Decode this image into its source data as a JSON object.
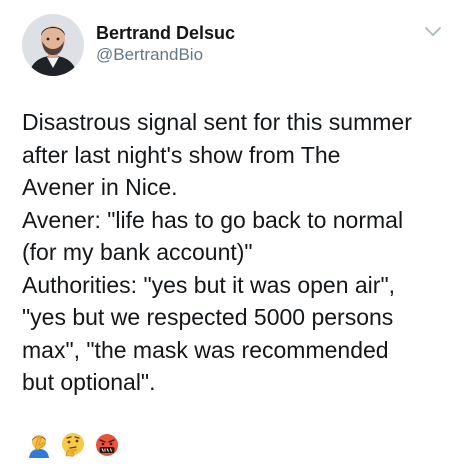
{
  "author": {
    "display_name": "Bertrand Delsuc",
    "handle": "@BertrandBio"
  },
  "tweet": {
    "lines": [
      "Disastrous signal sent for this summer",
      "after last night's show from The",
      "Avener in Nice.",
      "Avener: \"life has to go back to normal",
      "(for my bank account)\"",
      "Authorities: \"yes but it was open air\",",
      "\"yes but we respected 5000 persons",
      "max\", \"the mask was recommended",
      "but optional\"."
    ],
    "emojis": [
      "man-facepalming-icon",
      "thinking-face-icon",
      "face-with-symbols-on-mouth-icon"
    ]
  },
  "colors": {
    "text": "#14171a",
    "secondary": "#657786",
    "chevron": "#aab8c2"
  }
}
